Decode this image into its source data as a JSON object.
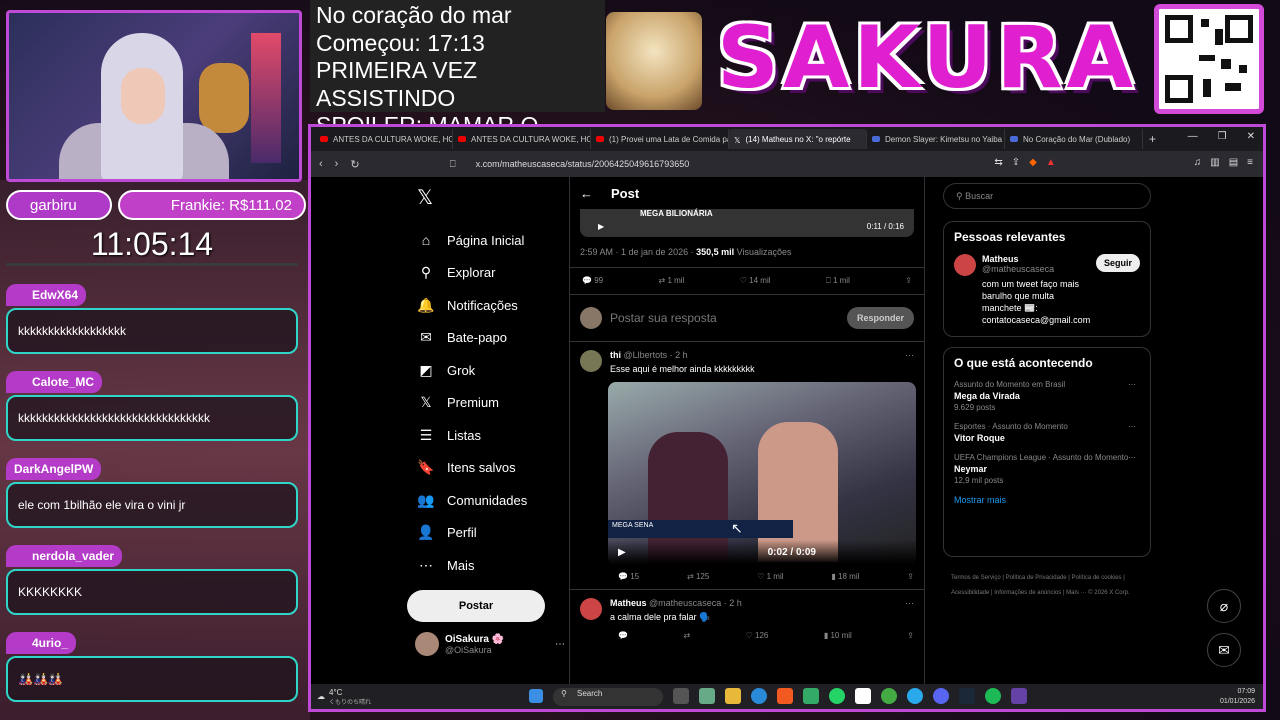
{
  "overlay": {
    "lines": [
      "No coração do mar",
      "Começou: 17:13",
      "PRIMEIRA VEZ ASSISTINDO",
      "SPOILER: MAMAR O CHAT"
    ],
    "logo": "SAKURA",
    "user_pill": "garbiru",
    "donation_pill": "Frankie: R$111.02",
    "clock": "11:05:14"
  },
  "chat": [
    {
      "name": "EdwX64",
      "msg": "kkkkkkkkkkkkkkkkkk"
    },
    {
      "name": "Calote_MC",
      "msg": "kkkkkkkkkkkkkkkkkkkkkkkkkkkkkkkk"
    },
    {
      "name": "DarkAngelPW",
      "msg": "ele com 1bilhão ele vira o vini jr"
    },
    {
      "name": "nerdola_vader",
      "msg": "KKKKKKKK"
    },
    {
      "name": "4urio_",
      "msg": "🎎🎎🎎"
    }
  ],
  "browser": {
    "tabs": [
      "ANTES DA CULTURA WOKE, HOLL",
      "ANTES DA CULTURA WOKE, HOLL",
      "(1) Provei uma Lata de Comida pa",
      "(14) Matheus no X: \"o repórte",
      "Demon Slayer: Kimetsu no Yaiba",
      "No Coração do Mar (Dublado)"
    ],
    "url": "x.com/matheuscaseca/status/2006425049616793650"
  },
  "xnav": {
    "items": [
      "Página Inicial",
      "Explorar",
      "Notificações",
      "Bate-papo",
      "Grok",
      "Premium",
      "Listas",
      "Itens salvos",
      "Comunidades",
      "Perfil",
      "Mais"
    ],
    "post_button": "Postar",
    "me_name": "OiSakura 🌸",
    "me_handle": "@OiSakura"
  },
  "center": {
    "title": "Post",
    "vid1_label": "MEGA BILIONÁRIA",
    "vid1_time": "0:11 / 0:16",
    "meta_time": "2:59 AM · 1 de jan de 2026 ·",
    "meta_views": "350,5 mil",
    "meta_views_label": "Visualizações",
    "acts": [
      "99",
      "1 mil",
      "14 mil",
      "1 mil"
    ],
    "reply_placeholder": "Postar sua resposta",
    "reply_button": "Responder",
    "t1_name": "thi",
    "t1_handle": "@Llbertots · 2 h",
    "t1_text": "Esse aqui é melhor ainda kkkkkkkkk",
    "vid2_lower": "MEGA SENA",
    "vid2_time": "0:02 / 0:09",
    "acts2": [
      "15",
      "125",
      "1 mil",
      "18 mil"
    ],
    "t2_name": "Matheus",
    "t2_handle": "@matheuscaseca · 2 h",
    "t2_text": "a calma dele pra falar 🗣️",
    "acts3": [
      "",
      "",
      "126",
      "10 mil"
    ]
  },
  "right": {
    "search": "Buscar",
    "people_title": "Pessoas relevantes",
    "person_name": "Matheus",
    "person_handle": "@matheuscaseca",
    "person_bio": "com um tweet faço mais barulho que multa manchete 📰: contatocaseca@gmail.com",
    "follow": "Seguir",
    "trends_title": "O que está acontecendo",
    "trends": [
      {
        "ctx": "Assunto do Momento em Brasil",
        "name": "Mega da Virada",
        "count": "9.629 posts"
      },
      {
        "ctx": "Esportes · Assunto do Momento",
        "name": "Vitor Roque",
        "count": ""
      },
      {
        "ctx": "UEFA Champions League · Assunto do Momento",
        "name": "Neymar",
        "count": "12,9 mil posts"
      }
    ],
    "show_more": "Mostrar mais",
    "footer": "Termos de Serviço | Política de Privacidade | Política de cookies | Acessibilidade | Informações de anúncios | Mais ··· © 2026 X Corp."
  },
  "taskbar": {
    "temp": "4°C",
    "weather": "くもりのち晴れ",
    "search": "Search",
    "time": "07:09",
    "date": "01/01/2026"
  }
}
